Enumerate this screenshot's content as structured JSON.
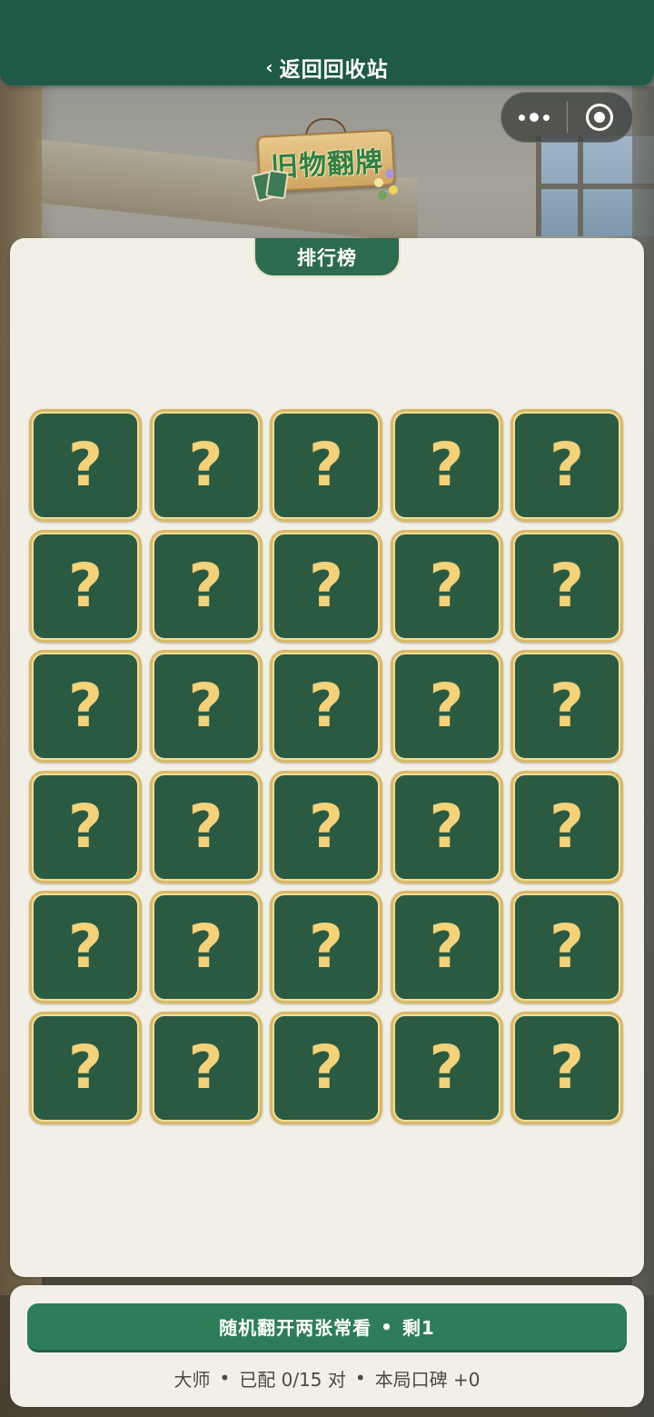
{
  "nav": {
    "back_chevron": "‹",
    "back_label": "返回回收站"
  },
  "capsule": {
    "more_icon": "more-dots-icon",
    "close_icon": "target-circle-icon"
  },
  "logo": {
    "title": "旧物翻牌"
  },
  "panel": {
    "leaderboard_label": "排行榜"
  },
  "cards": {
    "rows": 6,
    "columns": 5,
    "back_symbol": "?",
    "items": [
      "?",
      "?",
      "?",
      "?",
      "?",
      "?",
      "?",
      "?",
      "?",
      "?",
      "?",
      "?",
      "?",
      "?",
      "?",
      "?",
      "?",
      "?",
      "?",
      "?",
      "?",
      "?",
      "?",
      "?",
      "?",
      "?",
      "?",
      "?",
      "?",
      "?"
    ]
  },
  "action": {
    "peek_label": "随机翻开两张常看",
    "separator": "•",
    "remaining_label": "剩1"
  },
  "status": {
    "rank": "大师",
    "matched": "已配 0/15 对",
    "reputation": "本局口碑 +0",
    "separator": "•"
  },
  "colors": {
    "nav_bg": "#1e5a45",
    "card_back": "#2b5a43",
    "card_border": "#d9b866",
    "question_mark": "#f2d27a",
    "button_bg": "#2e7d59",
    "panel_bg": "#f2f0e6"
  }
}
